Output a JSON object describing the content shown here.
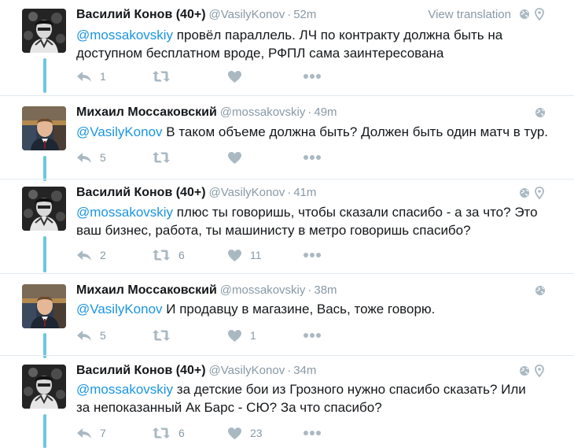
{
  "colors": {
    "thread_line": "#6cc6e0",
    "mention": "#1b95e0",
    "muted": "#8899a6",
    "icon": "#aab8c2"
  },
  "labels": {
    "view_translation": "View translation"
  },
  "tweets": [
    {
      "name": "Василий Конов (40+)",
      "handle": "@VasilyKonov",
      "separator": "·",
      "time": "52m",
      "show_translation": true,
      "line1_mention": "@mossakovskiy",
      "line1_text": " провёл параллель. ЛЧ по контракту должна быть на",
      "line2_text": "доступном бесплатном вроде, РФПЛ сама заинтересована",
      "reply_count": "1",
      "retweet_count": "",
      "like_count": ""
    },
    {
      "name": "Михаил Моссаковский",
      "handle": "@mossakovskiy",
      "separator": "·",
      "time": "49m",
      "line1_mention": "@VasilyKonov",
      "line1_text": " В таком объеме должна быть? Должен быть один матч в тур.",
      "line2_text": "",
      "reply_count": "5",
      "retweet_count": "",
      "like_count": ""
    },
    {
      "name": "Василий Конов (40+)",
      "handle": "@VasilyKonov",
      "separator": "·",
      "time": "41m",
      "line1_mention": "@mossakovskiy",
      "line1_text": " плюс ты говоришь, чтобы сказали спасибо - а за что? Это",
      "line2_text": "ваш бизнес, работа, ты машинисту в метро говоришь спасибо?",
      "reply_count": "2",
      "retweet_count": "6",
      "like_count": "11"
    },
    {
      "name": "Михаил Моссаковский",
      "handle": "@mossakovskiy",
      "separator": "·",
      "time": "38m",
      "line1_mention": "@VasilyKonov",
      "line1_text": " И продавцу в магазине, Вась, тоже говорю.",
      "line2_text": "",
      "reply_count": "5",
      "retweet_count": "",
      "like_count": "1"
    },
    {
      "name": "Василий Конов (40+)",
      "handle": "@VasilyKonov",
      "separator": "·",
      "time": "34m",
      "line1_mention": "@mossakovskiy",
      "line1_text": " за детские бои из Грозного нужно спасибо сказать? Или",
      "line2_text": "за непоказанный Ак Барс - СЮ? За что спасибо?",
      "reply_count": "7",
      "retweet_count": "6",
      "like_count": "23"
    }
  ]
}
